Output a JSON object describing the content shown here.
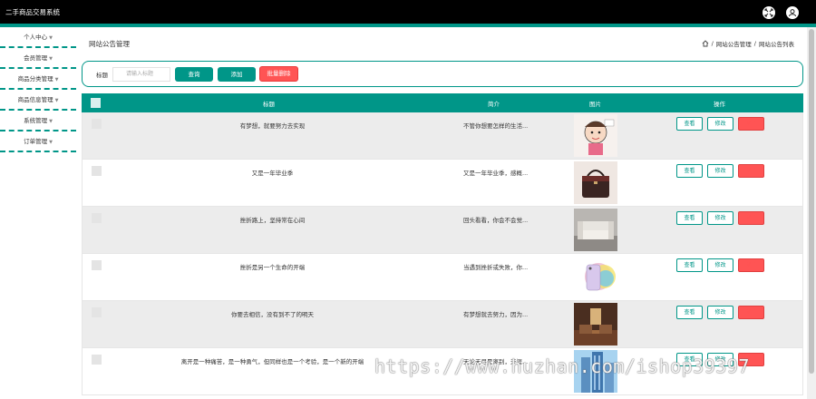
{
  "app": {
    "title": "二手商品交易系统"
  },
  "sidebar": {
    "items": [
      {
        "label": "个人中心"
      },
      {
        "label": "会员管理"
      },
      {
        "label": "商品分类管理"
      },
      {
        "label": "商品信息管理"
      },
      {
        "label": "系统管理"
      },
      {
        "label": "订单管理"
      }
    ]
  },
  "page": {
    "heading": "网站公告管理",
    "breadcrumb": {
      "sep": "/",
      "level1": "网站公告管理",
      "level2": "网站公告列表"
    }
  },
  "search": {
    "label": "标题",
    "placeholder": "请输入标题",
    "query_button": "查询",
    "add_button": "添加",
    "batch_delete_button": "批量删除"
  },
  "table": {
    "headers": {
      "title": "标题",
      "summary": "简介",
      "image": "图片",
      "actions": "操作"
    },
    "actions": {
      "view": "查看",
      "edit": "修改",
      "delete": "删除"
    },
    "rows": [
      {
        "title": "有梦想，就要努力去实现",
        "summary": "不管你想要怎样的生活...",
        "image": "cartoon"
      },
      {
        "title": "又是一年毕业季",
        "summary": "又是一年毕业季，感概...",
        "image": "handbag"
      },
      {
        "title": "挫折路上，坚持常在心间",
        "summary": "回头看看，你会不会觉...",
        "image": "sofa"
      },
      {
        "title": "挫折是另一个生命的开端",
        "summary": "当遇到挫折或失败，你...",
        "image": "phone"
      },
      {
        "title": "你要去相信，没有到不了的明天",
        "summary": "有梦想就去努力，因为...",
        "image": "room"
      },
      {
        "title": "离开是一种痛苦，是一种勇气，但同样也是一个考验，是一个新的开端",
        "summary": "无论无尽是离别，天涯...",
        "image": "building"
      }
    ]
  },
  "watermark": "https://www.huzhan.com/ishop39397",
  "colors": {
    "accent": "#009688",
    "danger": "#ff5454",
    "topbar": "#000000"
  },
  "icons": {
    "fullscreen": "fullscreen-icon",
    "user": "user-icon",
    "home": "home-icon"
  }
}
